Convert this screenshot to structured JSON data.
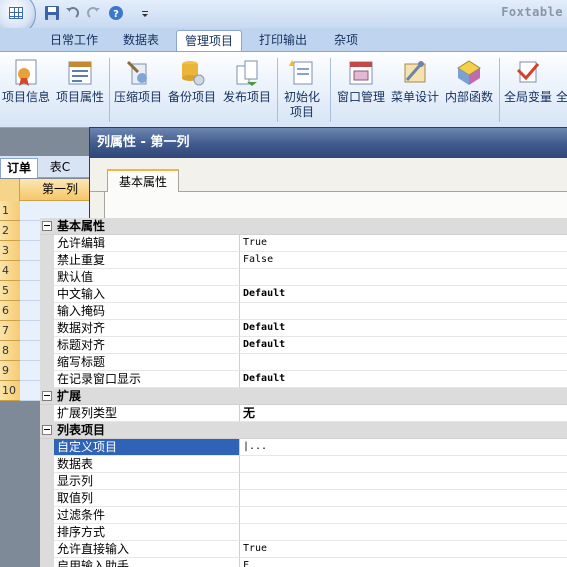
{
  "app": {
    "name": "Foxtable"
  },
  "ribbon_tabs": [
    {
      "label": "日常工作",
      "active": false
    },
    {
      "label": "数据表",
      "active": false
    },
    {
      "label": "管理项目",
      "active": true
    },
    {
      "label": "打印输出",
      "active": false
    },
    {
      "label": "杂项",
      "active": false
    }
  ],
  "ribbon_buttons": [
    {
      "label": "项目信息",
      "icon": "project-info-icon"
    },
    {
      "label": "项目属性",
      "icon": "project-properties-icon"
    },
    {
      "label": "压缩项目",
      "icon": "compress-project-icon"
    },
    {
      "label": "备份项目",
      "icon": "backup-project-icon"
    },
    {
      "label": "发布项目",
      "icon": "publish-project-icon"
    },
    {
      "label": "初始化",
      "label2": "项目",
      "icon": "initialize-project-icon"
    },
    {
      "label": "窗口管理",
      "icon": "window-manager-icon"
    },
    {
      "label": "菜单设计",
      "icon": "menu-design-icon"
    },
    {
      "label": "内部函数",
      "icon": "internal-functions-icon"
    },
    {
      "label": "全局变量",
      "icon": "global-variables-icon"
    },
    {
      "label": "全",
      "icon": "more-icon"
    }
  ],
  "sheet": {
    "tabs": [
      "订单",
      "表C"
    ],
    "column": "第一列",
    "row_numbers": [
      "1",
      "2",
      "3",
      "4",
      "5",
      "6",
      "7",
      "8",
      "9",
      "10"
    ]
  },
  "dialog": {
    "title": "列属性 - 第一列",
    "tab": "基本属性",
    "sections": [
      {
        "name": "基本属性",
        "rows": [
          {
            "name": "允许编辑",
            "value": "True"
          },
          {
            "name": "禁止重复",
            "value": "False"
          },
          {
            "name": "默认值",
            "value": ""
          },
          {
            "name": "中文输入",
            "value": "Default"
          },
          {
            "name": "输入掩码",
            "value": ""
          },
          {
            "name": "数据对齐",
            "value": "Default"
          },
          {
            "name": "标题对齐",
            "value": "Default"
          },
          {
            "name": "缩写标题",
            "value": ""
          },
          {
            "name": "在记录窗口显示",
            "value": "Default"
          }
        ]
      },
      {
        "name": "扩展",
        "rows": [
          {
            "name": "扩展列类型",
            "value": "无"
          }
        ]
      },
      {
        "name": "列表项目",
        "rows": [
          {
            "name": "自定义项目",
            "value": "|...",
            "selected": true
          },
          {
            "name": "数据表",
            "value": ""
          },
          {
            "name": "显示列",
            "value": ""
          },
          {
            "name": "取值列",
            "value": ""
          },
          {
            "name": "过滤条件",
            "value": ""
          },
          {
            "name": "排序方式",
            "value": ""
          },
          {
            "name": "允许直接输入",
            "value": "True"
          },
          {
            "name": "启用输入助手",
            "value": "F"
          }
        ]
      }
    ]
  }
}
